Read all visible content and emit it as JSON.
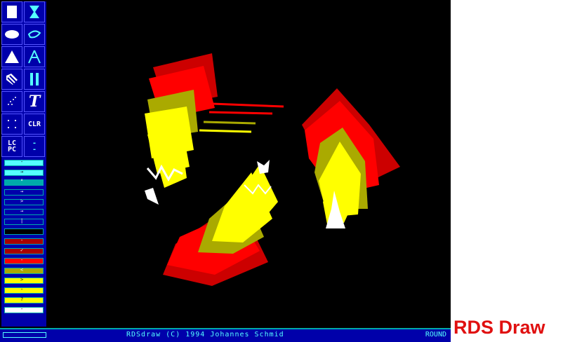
{
  "toolbar": {
    "tools": [
      {
        "name": "rectangle-tool",
        "icon": "filled-rectangle-icon"
      },
      {
        "name": "hourglass-tool",
        "icon": "hourglass-icon"
      },
      {
        "name": "ellipse-tool",
        "icon": "filled-ellipse-icon"
      },
      {
        "name": "freeform-tool",
        "icon": "lasso-icon"
      },
      {
        "name": "triangle-tool",
        "icon": "filled-triangle-icon"
      },
      {
        "name": "polyline-tool",
        "icon": "compass-icon"
      },
      {
        "name": "fill-tool",
        "icon": "hatch-fill-icon"
      },
      {
        "name": "line-width-tool",
        "icon": "vertical-bars-icon"
      },
      {
        "name": "spray-tool",
        "icon": "spray-icon"
      },
      {
        "name": "text-tool",
        "icon": "text-T-icon",
        "label": "T"
      },
      {
        "name": "grid-tool",
        "icon": "dots-icon"
      },
      {
        "name": "clear-tool",
        "label": "CLR"
      },
      {
        "name": "load-save-tool",
        "label": "LC\nPC"
      },
      {
        "name": "option-tool",
        "label": "-\n-"
      }
    ],
    "swatches": [
      {
        "color": "#55ffff",
        "mark": "-"
      },
      {
        "color": "#55ffff",
        "mark": "→"
      },
      {
        "color": "#00aaaa",
        "mark": "°"
      },
      {
        "color": "#0000aa",
        "mark": "→"
      },
      {
        "color": "#0000aa",
        "mark": ">"
      },
      {
        "color": "#0000aa",
        "mark": "→"
      },
      {
        "color": "#0000aa",
        "mark": "|"
      },
      {
        "color": "#000000",
        "mark": ""
      },
      {
        "color": "#aa0000",
        "mark": "-"
      },
      {
        "color": "#aa0000",
        "mark": "✓"
      },
      {
        "color": "#ff0000",
        "mark": "-"
      },
      {
        "color": "#aaaa00",
        "mark": "<"
      },
      {
        "color": "#ffff00",
        "mark": ">"
      },
      {
        "color": "#ffff00",
        "mark": "-"
      },
      {
        "color": "#ffff00",
        "mark": "?"
      },
      {
        "color": "#ffffff",
        "mark": "-"
      }
    ]
  },
  "colors": {
    "white": "#ffffff",
    "yellow": "#ffff00",
    "olive": "#aaaa00",
    "red": "#ff0000",
    "darkred": "#cc0000",
    "blue": "#0000aa",
    "cyan": "#55ffff"
  },
  "statusbar": {
    "text": "RDSdraw  (C) 1994 Johannes Schmid",
    "mode": "ROUND"
  },
  "caption": "RDS Draw"
}
